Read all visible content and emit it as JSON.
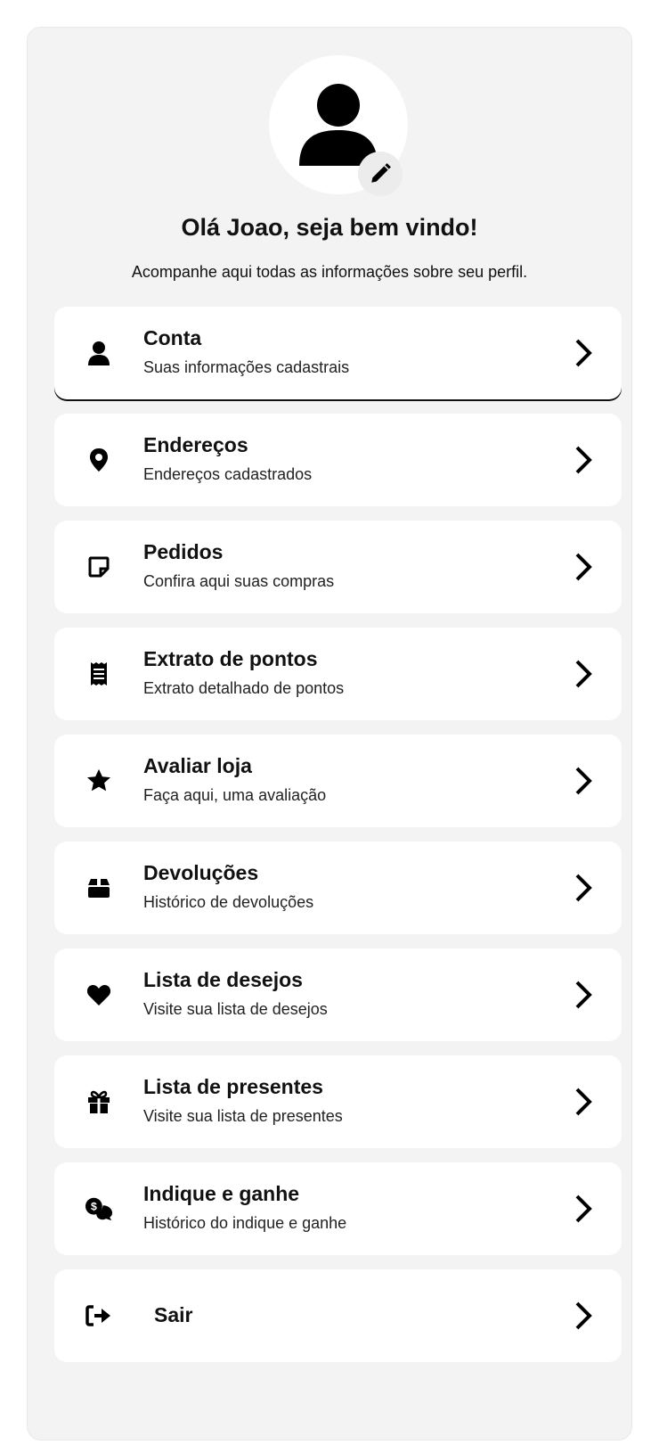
{
  "profile": {
    "avatar_icon": "user-icon",
    "edit_icon": "pencil-icon",
    "greeting": "Olá Joao, seja bem vindo!",
    "subtitle": "Acompanhe aqui todas as informações sobre seu perfil."
  },
  "menu": [
    {
      "title": "Conta",
      "description": "Suas informações cadastrais",
      "icon": "user-icon",
      "active": true
    },
    {
      "title": "Endereços",
      "description": "Endereços cadastrados",
      "icon": "map-pin-icon"
    },
    {
      "title": "Pedidos",
      "description": "Confira aqui suas compras",
      "icon": "note-icon"
    },
    {
      "title": "Extrato de pontos",
      "description": "Extrato detalhado de pontos",
      "icon": "receipt-icon"
    },
    {
      "title": "Avaliar loja",
      "description": "Faça aqui, uma avaliação",
      "icon": "star-icon"
    },
    {
      "title": "Devoluções",
      "description": "Histórico de devoluções",
      "icon": "box-icon"
    },
    {
      "title": "Lista de desejos",
      "description": "Visite sua lista de desejos",
      "icon": "heart-icon"
    },
    {
      "title": "Lista de presentes",
      "description": "Visite sua lista de presentes",
      "icon": "gift-icon"
    },
    {
      "title": "Indique e ganhe",
      "description": "Histórico do indique e ganhe",
      "icon": "referral-icon"
    },
    {
      "title": "Sair",
      "icon": "logout-icon"
    }
  ],
  "chevron_icon": "chevron-right-icon",
  "colors": {
    "panel_background": "#f3f3f3",
    "card_background": "#ffffff",
    "text": "#111111"
  }
}
